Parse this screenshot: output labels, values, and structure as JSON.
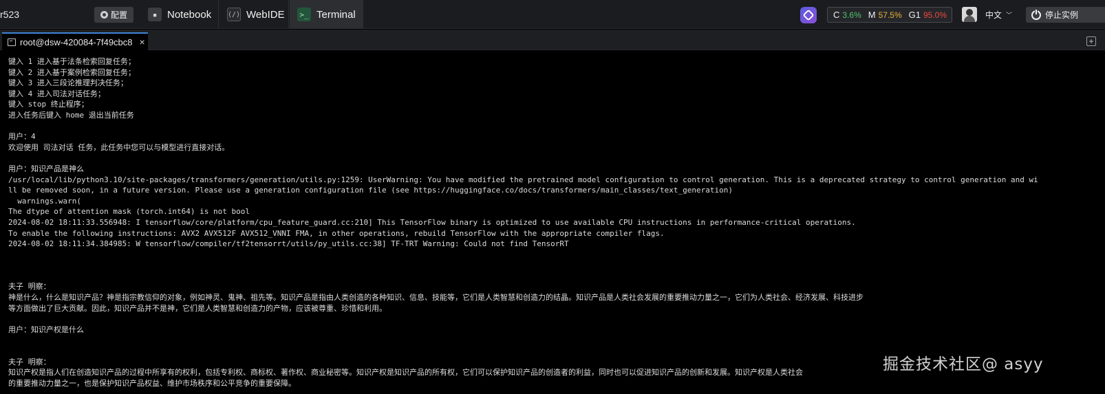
{
  "topbar": {
    "instance": "r523",
    "config_label": "配置",
    "tabs": [
      {
        "label": "Notebook",
        "icon": "notebook-icon"
      },
      {
        "label": "WebIDE",
        "icon": "webide-icon"
      },
      {
        "label": "Terminal",
        "icon": "terminal-icon"
      }
    ],
    "usage": {
      "c_label": "C",
      "c_value": "3.6%",
      "m_label": "M",
      "m_value": "57.5%",
      "g_label": "G1",
      "g_value": "95.0%"
    },
    "language": "中文",
    "stop_label": "停止实例"
  },
  "terminal_tab": {
    "title": "root@dsw-420084-7f49cbc8",
    "close": "×",
    "add": "+"
  },
  "terminal_lines": [
    "键入 1 进入基于法条检索回复任务；",
    "键入 2 进入基于案例检索回复任务；",
    "键入 3 进入三段论推理判决任务；",
    "键入 4 进入司法对话任务；",
    "键入 stop 终止程序；",
    "进入任务后键入 home 退出当前任务",
    "",
    "用户：4",
    "欢迎使用 司法对话 任务，此任务中您可以与模型进行直接对话。",
    "",
    "用户：知识产品是神么",
    "/usr/local/lib/python3.10/site-packages/transformers/generation/utils.py:1259: UserWarning: You have modified the pretrained model configuration to control generation. This is a deprecated strategy to control generation and wi",
    "ll be removed soon, in a future version. Please use a generation configuration file (see https://huggingface.co/docs/transformers/main_classes/text_generation)",
    "  warnings.warn(",
    "The dtype of attention mask (torch.int64) is not bool",
    "2024-08-02 18:11:33.556948: I tensorflow/core/platform/cpu_feature_guard.cc:210] This TensorFlow binary is optimized to use available CPU instructions in performance-critical operations.",
    "To enable the following instructions: AVX2 AVX512F AVX512_VNNI FMA, in other operations, rebuild TensorFlow with the appropriate compiler flags.",
    "2024-08-02 18:11:34.384985: W tensorflow/compiler/tf2tensorrt/utils/py_utils.cc:38] TF-TRT Warning: Could not find TensorRT",
    "",
    "",
    "",
    "夫子 明察：",
    "神是什么，什么是知识产品？神是指宗教信仰的对象，例如神灵、鬼神、祖先等。知识产品是指由人类创造的各种知识、信息、技能等，它们是人类智慧和创造力的结晶。知识产品是人类社会发展的重要推动力量之一，它们为人类社会、经济发展、科技进步",
    "等方面做出了巨大贡献。因此，知识产品并不是神，它们是人类智慧和创造力的产物，应该被尊重、珍惜和利用。",
    "",
    "用户：知识产权是什么",
    "",
    "",
    "夫子 明察：",
    "知识产权是指人们在创造知识产品的过程中所享有的权利，包括专利权、商标权、著作权、商业秘密等。知识产权是知识产品的所有权，它们可以保护知识产品的创造者的利益，同时也可以促进知识产品的创新和发展。知识产权是人类社会",
    "的重要推动力量之一，也是保护知识产品权益、维护市场秩序和公平竞争的重要保障。"
  ],
  "watermark": "掘金技术社区@ asyy"
}
